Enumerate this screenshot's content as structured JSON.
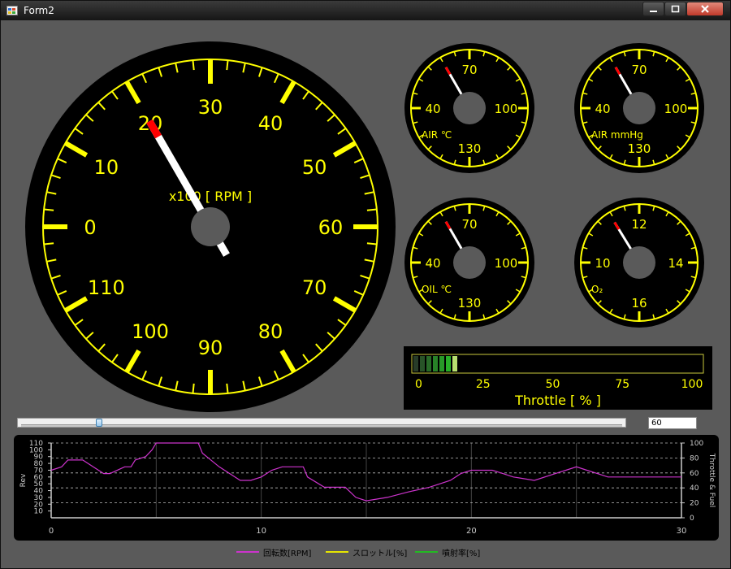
{
  "window": {
    "title": "Form2"
  },
  "rpm_gauge": {
    "ticks": [
      "0",
      "10",
      "20",
      "30",
      "40",
      "50",
      "60",
      "70",
      "80",
      "90",
      "100",
      "110"
    ],
    "unit_label": "x100 [ RPM ]",
    "value": 20,
    "ring_color": "#ffff00",
    "needle_color": "#ffffff",
    "needle_tip_color": "#ff0000"
  },
  "small_gauges": [
    {
      "name": "air-temp",
      "labels": [
        "40",
        "70",
        "100",
        "130"
      ],
      "unit": "AIR ℃",
      "value": 60
    },
    {
      "name": "air-pressure",
      "labels": [
        "40",
        "70",
        "100",
        "130"
      ],
      "unit": "AIR mmHg",
      "value": 60
    },
    {
      "name": "oil-temp",
      "labels": [
        "40",
        "70",
        "100",
        "130"
      ],
      "unit": "OIL ℃",
      "value": 60
    },
    {
      "name": "o2",
      "labels": [
        "10",
        "12",
        "14",
        "16"
      ],
      "unit": "O₂",
      "value": 11.3
    }
  ],
  "throttle": {
    "label": "Throttle [ % ]",
    "scale": [
      "0",
      "25",
      "50",
      "75",
      "100"
    ],
    "value_percent": 16,
    "bar_color": "#3a9a2a"
  },
  "slider": {
    "value_percent": 13,
    "input_value": "60"
  },
  "chart_data": {
    "type": "line",
    "x_ticks": [
      "0",
      "10",
      "20",
      "30"
    ],
    "xlim": [
      0,
      30
    ],
    "ylabel": "Rev",
    "y_ticks": [
      "10",
      "20",
      "30",
      "40",
      "50",
      "60",
      "70",
      "80",
      "90",
      "100",
      "110"
    ],
    "ylim": [
      0,
      110
    ],
    "y2label": "Throttle & Fuel",
    "y2_ticks": [
      "0",
      "20",
      "40",
      "60",
      "80",
      "100"
    ],
    "y2lim": [
      0,
      100
    ],
    "grid": true,
    "legend_position": "bottom",
    "series": [
      {
        "name": "回転数[RPM]",
        "color": "#cc33cc",
        "x": [
          0,
          0.5,
          0.8,
          1.5,
          2.0,
          2.5,
          2.8,
          3.5,
          3.8,
          4.0,
          4.5,
          4.8,
          5.0,
          7.0,
          7.2,
          8.0,
          9.0,
          9.5,
          10.0,
          10.5,
          11.0,
          11.5,
          12.0,
          12.2,
          13.0,
          14.0,
          14.5,
          15.0,
          16.0,
          17.0,
          18.0,
          19.0,
          19.5,
          20.0,
          21.0,
          21.5,
          22.0,
          23.0,
          24.0,
          24.5,
          25.0,
          25.5,
          26.0,
          26.5,
          27.0,
          28.0,
          29.0,
          30.0
        ],
        "y": [
          70,
          75,
          85,
          85,
          75,
          65,
          65,
          75,
          75,
          85,
          90,
          100,
          110,
          110,
          95,
          75,
          55,
          55,
          60,
          70,
          75,
          75,
          75,
          60,
          45,
          45,
          30,
          25,
          30,
          38,
          45,
          55,
          65,
          70,
          70,
          65,
          60,
          55,
          65,
          70,
          75,
          70,
          65,
          60,
          60,
          60,
          60,
          60
        ]
      },
      {
        "name": "スロットル[%]",
        "color": "#e6e600",
        "x": [],
        "y": []
      },
      {
        "name": "噴射率[%]",
        "color": "#22bb22",
        "x": [],
        "y": []
      }
    ]
  }
}
